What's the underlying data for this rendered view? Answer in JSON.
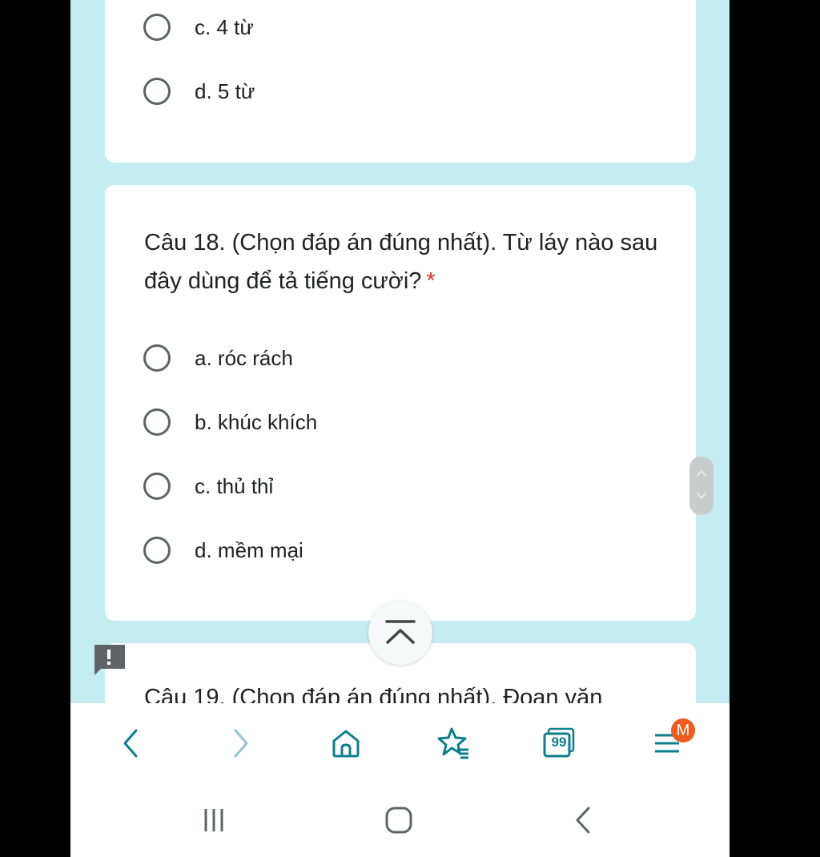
{
  "previous_question": {
    "options": [
      {
        "label": "c. 4 từ"
      },
      {
        "label": "d. 5 từ"
      }
    ]
  },
  "question_18": {
    "title": "Câu 18. (Chọn đáp án đúng nhất). Từ láy nào sau đây dùng để tả tiếng cười?",
    "required_marker": "*",
    "options": [
      {
        "label": "a. róc rách"
      },
      {
        "label": "b. khúc khích"
      },
      {
        "label": "c. thủ thỉ"
      },
      {
        "label": "d. mềm mại"
      }
    ]
  },
  "question_19": {
    "title": "Câu 19. (Chọn đáp án đúng nhất). Đoạn văn"
  },
  "browser_toolbar": {
    "tab_count": "99",
    "menu_badge": "M",
    "accent_color": "#0b7f8c",
    "icons": [
      "chevron-left-icon",
      "chevron-right-icon",
      "home-icon",
      "bookmarks-star-icon",
      "tabs-icon",
      "menu-icon"
    ]
  },
  "system_nav": {
    "icons": [
      "recents-icon",
      "home-square-icon",
      "back-icon"
    ]
  }
}
